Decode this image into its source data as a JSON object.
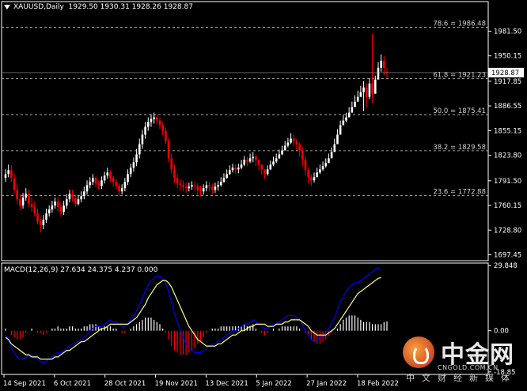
{
  "main_header": {
    "symbol_label": "XAUUSD,Daily",
    "ohlc": "1929.50 1930.31 1928.26 1928.87"
  },
  "macd_header": {
    "label": "MACD(12,26,9) 27.634 24.375 4.237 0.000"
  },
  "logo": {
    "name_cn": "中金网",
    "url": "CNGOLD.COM.CN",
    "tagline_cn": "中文财经新媒体"
  },
  "colors": {
    "background": "#000000",
    "bull_candle": "#ffffff",
    "bear_candle": "#ff0000",
    "macd_hist_positive": "#ffffff",
    "macd_hist_negative": "#ff0000",
    "macd_line": "#0000ff",
    "signal_line": "#ffff88"
  },
  "chart_data": [
    {
      "type": "candlestick",
      "title": "XAUUSD,Daily",
      "timeframe": "Daily",
      "current_price": 1928.87,
      "x_tick_labels": [
        "14 Sep 2021",
        "6 Oct 2021",
        "28 Oct 2021",
        "19 Nov 2021",
        "13 Dec 2021",
        "5 Jan 2022",
        "27 Jan 2022",
        "18 Feb 2022"
      ],
      "y_tick_labels": [
        "1981.50",
        "1950.15",
        "1917.85",
        "1886.55",
        "1855.15",
        "1823.80",
        "1791.50",
        "1760.15",
        "1728.80",
        "1697.45"
      ],
      "ylim": [
        1690,
        2005
      ],
      "fibonacci_levels": [
        {
          "label": "78.6 = 1986.48",
          "value": 1986.48
        },
        {
          "label": "61.8 = 1921.23",
          "value": 1921.23
        },
        {
          "label": "50.0 = 1875.41",
          "value": 1875.41
        },
        {
          "label": "38.2 = 1829.58",
          "value": 1829.58
        },
        {
          "label": "23.6 = 1772.88",
          "value": 1772.88
        }
      ],
      "close_series": [
        1800,
        1805,
        1795,
        1780,
        1768,
        1760,
        1770,
        1775,
        1762,
        1758,
        1750,
        1740,
        1735,
        1742,
        1750,
        1755,
        1760,
        1765,
        1758,
        1752,
        1760,
        1768,
        1775,
        1770,
        1762,
        1768,
        1772,
        1778,
        1786,
        1790,
        1795,
        1788,
        1785,
        1792,
        1798,
        1802,
        1795,
        1790,
        1785,
        1778,
        1782,
        1790,
        1800,
        1808,
        1815,
        1825,
        1838,
        1850,
        1860,
        1866,
        1870,
        1872,
        1868,
        1862,
        1855,
        1842,
        1820,
        1806,
        1795,
        1788,
        1786,
        1784,
        1782,
        1784,
        1786,
        1785,
        1780,
        1778,
        1782,
        1786,
        1784,
        1780,
        1784,
        1786,
        1790,
        1795,
        1800,
        1805,
        1808,
        1806,
        1808,
        1812,
        1818,
        1816,
        1820,
        1822,
        1818,
        1812,
        1806,
        1800,
        1806,
        1812,
        1816,
        1820,
        1825,
        1830,
        1836,
        1840,
        1845,
        1842,
        1838,
        1830,
        1818,
        1805,
        1796,
        1792,
        1796,
        1802,
        1806,
        1810,
        1814,
        1820,
        1828,
        1838,
        1850,
        1862,
        1868,
        1872,
        1878,
        1885,
        1892,
        1898,
        1904,
        1910,
        1898,
        1915,
        1902,
        1920,
        1935,
        1944,
        1935,
        1928.87
      ],
      "open_series": [
        1795,
        1800,
        1805,
        1795,
        1780,
        1768,
        1760,
        1770,
        1775,
        1762,
        1758,
        1750,
        1740,
        1735,
        1742,
        1750,
        1755,
        1760,
        1765,
        1758,
        1752,
        1760,
        1768,
        1775,
        1770,
        1762,
        1768,
        1772,
        1778,
        1786,
        1790,
        1795,
        1788,
        1785,
        1792,
        1798,
        1802,
        1795,
        1790,
        1785,
        1778,
        1782,
        1790,
        1800,
        1808,
        1815,
        1825,
        1838,
        1850,
        1860,
        1866,
        1870,
        1872,
        1868,
        1862,
        1855,
        1842,
        1820,
        1806,
        1795,
        1788,
        1786,
        1784,
        1782,
        1784,
        1786,
        1785,
        1780,
        1778,
        1782,
        1786,
        1784,
        1780,
        1784,
        1786,
        1790,
        1795,
        1800,
        1805,
        1808,
        1806,
        1808,
        1812,
        1818,
        1816,
        1820,
        1822,
        1818,
        1812,
        1806,
        1800,
        1806,
        1812,
        1816,
        1820,
        1825,
        1830,
        1836,
        1840,
        1845,
        1842,
        1838,
        1830,
        1818,
        1805,
        1796,
        1792,
        1796,
        1802,
        1806,
        1810,
        1814,
        1820,
        1828,
        1838,
        1850,
        1862,
        1868,
        1872,
        1878,
        1885,
        1892,
        1898,
        1904,
        1910,
        1898,
        1915,
        1902,
        1920,
        1935,
        1944,
        1929.5
      ],
      "high_series": [
        1806,
        1812,
        1811,
        1800,
        1788,
        1774,
        1776,
        1782,
        1780,
        1770,
        1765,
        1756,
        1746,
        1748,
        1756,
        1760,
        1766,
        1770,
        1770,
        1764,
        1766,
        1774,
        1780,
        1780,
        1774,
        1773,
        1778,
        1784,
        1792,
        1796,
        1800,
        1797,
        1792,
        1797,
        1803,
        1808,
        1805,
        1798,
        1794,
        1788,
        1787,
        1795,
        1806,
        1813,
        1821,
        1832,
        1845,
        1856,
        1866,
        1872,
        1876,
        1878,
        1876,
        1872,
        1866,
        1859,
        1846,
        1826,
        1812,
        1800,
        1794,
        1792,
        1789,
        1789,
        1791,
        1791,
        1788,
        1785,
        1787,
        1791,
        1790,
        1788,
        1789,
        1791,
        1796,
        1801,
        1806,
        1811,
        1813,
        1812,
        1813,
        1818,
        1823,
        1822,
        1826,
        1828,
        1825,
        1818,
        1812,
        1806,
        1811,
        1817,
        1822,
        1826,
        1831,
        1836,
        1842,
        1846,
        1852,
        1850,
        1845,
        1840,
        1834,
        1822,
        1808,
        1800,
        1802,
        1808,
        1812,
        1816,
        1820,
        1826,
        1834,
        1845,
        1857,
        1868,
        1875,
        1878,
        1885,
        1892,
        1900,
        1906,
        1912,
        1918,
        1915,
        1922,
        1978,
        1925,
        1942,
        1952,
        1950,
        1935
      ],
      "low_series": [
        1790,
        1796,
        1790,
        1775,
        1762,
        1755,
        1756,
        1766,
        1758,
        1752,
        1746,
        1736,
        1726,
        1730,
        1738,
        1746,
        1751,
        1756,
        1752,
        1746,
        1748,
        1756,
        1764,
        1765,
        1758,
        1760,
        1764,
        1768,
        1774,
        1782,
        1786,
        1783,
        1780,
        1781,
        1788,
        1794,
        1790,
        1784,
        1780,
        1772,
        1774,
        1778,
        1786,
        1796,
        1803,
        1810,
        1820,
        1832,
        1845,
        1855,
        1860,
        1864,
        1863,
        1857,
        1849,
        1838,
        1815,
        1800,
        1789,
        1782,
        1779,
        1778,
        1776,
        1778,
        1780,
        1779,
        1774,
        1772,
        1774,
        1778,
        1778,
        1774,
        1776,
        1779,
        1784,
        1789,
        1794,
        1799,
        1802,
        1800,
        1801,
        1806,
        1810,
        1810,
        1814,
        1815,
        1810,
        1805,
        1799,
        1794,
        1798,
        1805,
        1810,
        1814,
        1819,
        1824,
        1830,
        1834,
        1838,
        1835,
        1830,
        1822,
        1810,
        1798,
        1788,
        1785,
        1789,
        1796,
        1800,
        1804,
        1808,
        1814,
        1822,
        1832,
        1844,
        1855,
        1862,
        1866,
        1872,
        1879,
        1886,
        1892,
        1898,
        1880,
        1885,
        1895,
        1890,
        1908,
        1925,
        1930,
        1925,
        1922
      ]
    },
    {
      "type": "line",
      "title": "MACD(12,26,9) 27.634 24.375 4.237 0.000",
      "y_tick_labels": [
        "29.848",
        "0.00",
        "-18.85"
      ],
      "ylim": [
        -20,
        31
      ],
      "series": [
        {
          "name": "MACD",
          "color": "#0000ff",
          "values": [
            -2,
            -4,
            -8,
            -10,
            -12,
            -13,
            -13,
            -12,
            -11,
            -11,
            -12,
            -13,
            -14,
            -15,
            -14,
            -13,
            -12,
            -11,
            -10,
            -10,
            -9,
            -8,
            -7,
            -6,
            -6,
            -5,
            -4,
            -3,
            -2,
            0,
            1,
            2,
            2,
            2,
            3,
            4,
            5,
            4,
            4,
            3,
            2,
            2,
            3,
            5,
            7,
            9,
            12,
            15,
            18,
            21,
            23,
            24,
            25,
            25,
            24,
            22,
            18,
            13,
            8,
            4,
            0,
            -3,
            -6,
            -8,
            -9,
            -10,
            -10,
            -10,
            -9,
            -8,
            -7,
            -6,
            -6,
            -5,
            -4,
            -3,
            -2,
            -1,
            0,
            0,
            1,
            2,
            3,
            3,
            4,
            5,
            4,
            3,
            2,
            1,
            1,
            2,
            3,
            3,
            4,
            5,
            6,
            7,
            7,
            7,
            6,
            5,
            3,
            0,
            -2,
            -4,
            -5,
            -4,
            -3,
            -2,
            -1,
            1,
            3,
            6,
            10,
            13,
            16,
            18,
            20,
            21,
            22,
            22,
            23,
            24,
            25,
            26,
            27,
            28,
            29,
            27.634
          ]
        },
        {
          "name": "Signal",
          "color": "#ffff88",
          "values": [
            -3,
            -4,
            -6,
            -7,
            -8,
            -9,
            -10,
            -11,
            -11,
            -12,
            -12,
            -12,
            -13,
            -13,
            -13,
            -13,
            -13,
            -12,
            -12,
            -11,
            -10,
            -9,
            -9,
            -8,
            -7,
            -6,
            -5,
            -5,
            -4,
            -3,
            -2,
            -1,
            0,
            1,
            1,
            2,
            3,
            3,
            3,
            3,
            3,
            3,
            3,
            4,
            5,
            6,
            8,
            10,
            12,
            15,
            17,
            19,
            21,
            22,
            23,
            23,
            22,
            20,
            17,
            14,
            11,
            8,
            5,
            2,
            0,
            -2,
            -4,
            -5,
            -6,
            -7,
            -7,
            -7,
            -7,
            -6,
            -6,
            -5,
            -4,
            -3,
            -2,
            -2,
            -1,
            0,
            0,
            1,
            2,
            2,
            3,
            3,
            3,
            3,
            2,
            2,
            2,
            3,
            3,
            3,
            4,
            4,
            5,
            5,
            5,
            5,
            4,
            3,
            2,
            0,
            -1,
            -2,
            -2,
            -2,
            -2,
            -1,
            0,
            1,
            3,
            5,
            7,
            9,
            11,
            13,
            15,
            17,
            18,
            19,
            20,
            21,
            22,
            23,
            24,
            24.375
          ]
        }
      ],
      "histogram": [
        1,
        0,
        -2,
        -3,
        -4,
        -4,
        -3,
        -1,
        0,
        1,
        0,
        -1,
        -1,
        -2,
        -1,
        0,
        1,
        1,
        2,
        1,
        1,
        1,
        2,
        2,
        1,
        1,
        1,
        2,
        2,
        3,
        3,
        3,
        2,
        1,
        2,
        2,
        2,
        1,
        1,
        0,
        -1,
        -1,
        0,
        1,
        2,
        3,
        4,
        5,
        6,
        6,
        6,
        5,
        4,
        3,
        1,
        -1,
        -4,
        -7,
        -9,
        -10,
        -11,
        -11,
        -11,
        -10,
        -9,
        -8,
        -6,
        -5,
        -3,
        -1,
        0,
        1,
        1,
        1,
        2,
        2,
        2,
        2,
        2,
        2,
        2,
        2,
        3,
        2,
        2,
        3,
        1,
        0,
        -1,
        -2,
        -1,
        0,
        1,
        0,
        1,
        2,
        2,
        2,
        2,
        2,
        2,
        1,
        0,
        -1,
        -2,
        -4,
        -5,
        -6,
        -6,
        -5,
        -4,
        -2,
        -1,
        0,
        1,
        3,
        5,
        6,
        7,
        7,
        7,
        6,
        5,
        4,
        4,
        4,
        3,
        3,
        3,
        3,
        4,
        4.237
      ]
    }
  ]
}
